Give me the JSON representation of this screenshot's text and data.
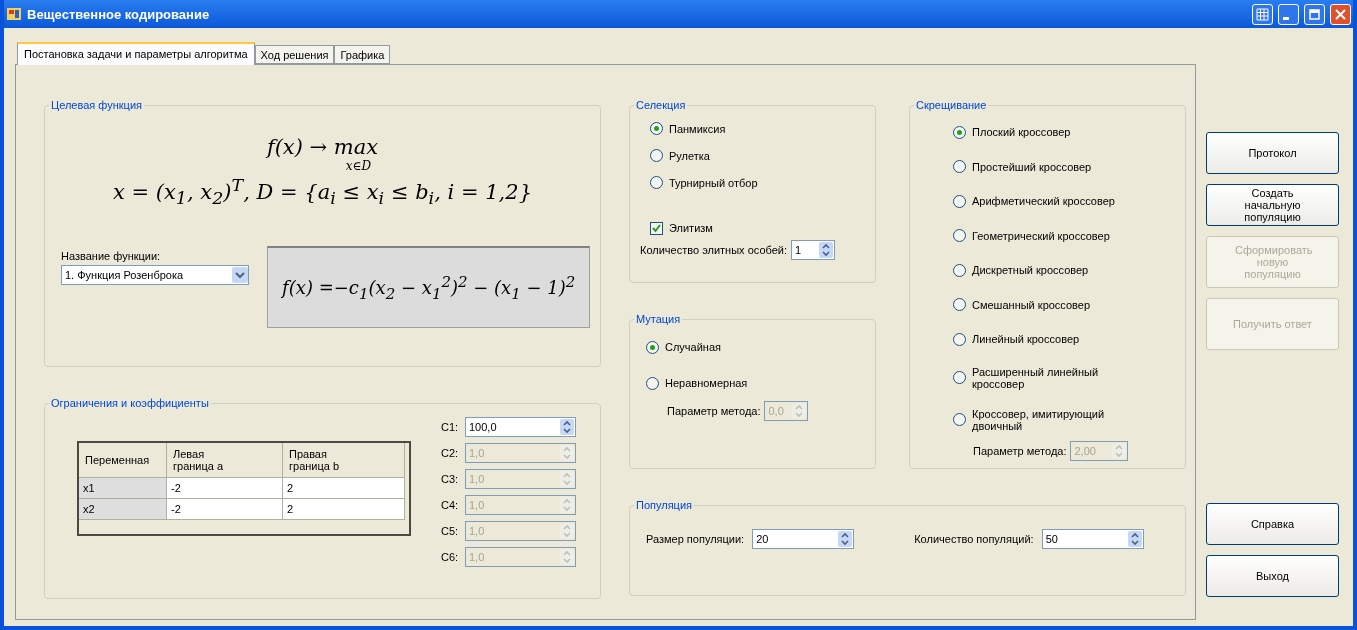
{
  "window": {
    "title": "Вещественное кодирование"
  },
  "tabs": [
    {
      "label": "Постановка задачи и параметры алгоритма",
      "selected": true
    },
    {
      "label": "Ход решения",
      "selected": false
    },
    {
      "label": "Графика",
      "selected": false
    }
  ],
  "objective": {
    "title": "Целевая функция",
    "goal": "f(x) → max",
    "goal_under": "x∈D",
    "domain": "x = (x$_{1}$, x$_{2}$)$^{T}$, D = {a$_{i}$ ≤ x$_{i}$ ≤ b$_{i}$, i = 1,2}",
    "function_label": "Название функции:",
    "function_value": "1. Функция Розенброка",
    "function_formula": "f(x) =−c$_{1}$(x$_{2}$ − x$_{1}$$^{2}$)$^{2}$ − (x$_{1}$ − 1)$^{2}$"
  },
  "constraints": {
    "title": "Ограничения и коэффициенты",
    "columns": [
      "Переменная",
      "Левая граница a",
      "Правая граница b"
    ],
    "rows": [
      {
        "cells": [
          "x1",
          "-2",
          "2"
        ]
      },
      {
        "cells": [
          "x2",
          "-2",
          "2"
        ]
      }
    ],
    "coefficients": [
      {
        "label": "C1:",
        "value": "100,0",
        "disabled": false
      },
      {
        "label": "C2:",
        "value": "1,0",
        "disabled": true
      },
      {
        "label": "C3:",
        "value": "1,0",
        "disabled": true
      },
      {
        "label": "C4:",
        "value": "1,0",
        "disabled": true
      },
      {
        "label": "C5:",
        "value": "1,0",
        "disabled": true
      },
      {
        "label": "C6:",
        "value": "1,0",
        "disabled": true
      }
    ]
  },
  "selection": {
    "title": "Селекция",
    "options": [
      {
        "label": "Панмиксия",
        "selected": true
      },
      {
        "label": "Рулетка",
        "selected": false
      },
      {
        "label": "Турнирный отбор",
        "selected": false
      }
    ],
    "elitism": {
      "label": "Элитизм",
      "checked": true
    },
    "elite_count": {
      "label": "Количество элитных особей:",
      "value": "1",
      "disabled": false
    }
  },
  "mutation": {
    "title": "Мутация",
    "options": [
      {
        "label": "Случайная",
        "selected": true
      },
      {
        "label": "Неравномерная",
        "selected": false
      }
    ],
    "parameter": {
      "label": "Параметр метода:",
      "value": "0,0",
      "disabled": true
    }
  },
  "crossover": {
    "title": "Скрещивание",
    "options": [
      {
        "label": "Плоский кроссовер",
        "selected": true
      },
      {
        "label": "Простейший кроссовер",
        "selected": false
      },
      {
        "label": "Арифметический кроссовер",
        "selected": false
      },
      {
        "label": "Геометрический кроссовер",
        "selected": false
      },
      {
        "label": "Дискретный кроссовер",
        "selected": false
      },
      {
        "label": "Смешанный кроссовер",
        "selected": false
      },
      {
        "label": "Линейный кроссовер",
        "selected": false
      },
      {
        "label": "Расширенный линейный кроссовер",
        "selected": false
      },
      {
        "label": "Кроссовер, имитирующий двоичный",
        "selected": false
      }
    ],
    "parameter": {
      "label": "Параметр метода:",
      "value": "2,00",
      "disabled": true
    }
  },
  "population": {
    "title": "Популяция",
    "fields": [
      {
        "label": "Размер популяции:",
        "value": "20",
        "disabled": false
      },
      {
        "label": "Количество популяций:",
        "value": "50",
        "disabled": false
      }
    ]
  },
  "buttons_top": [
    {
      "label": "Протокол",
      "disabled": false
    },
    {
      "label": "Создать начальную популяцию",
      "disabled": false
    },
    {
      "label": "Сформировать новую популяцию",
      "disabled": true
    },
    {
      "label": "Получить ответ",
      "disabled": true
    }
  ],
  "buttons_bottom": [
    {
      "label": "Справка",
      "disabled": false
    },
    {
      "label": "Выход",
      "disabled": false
    }
  ]
}
